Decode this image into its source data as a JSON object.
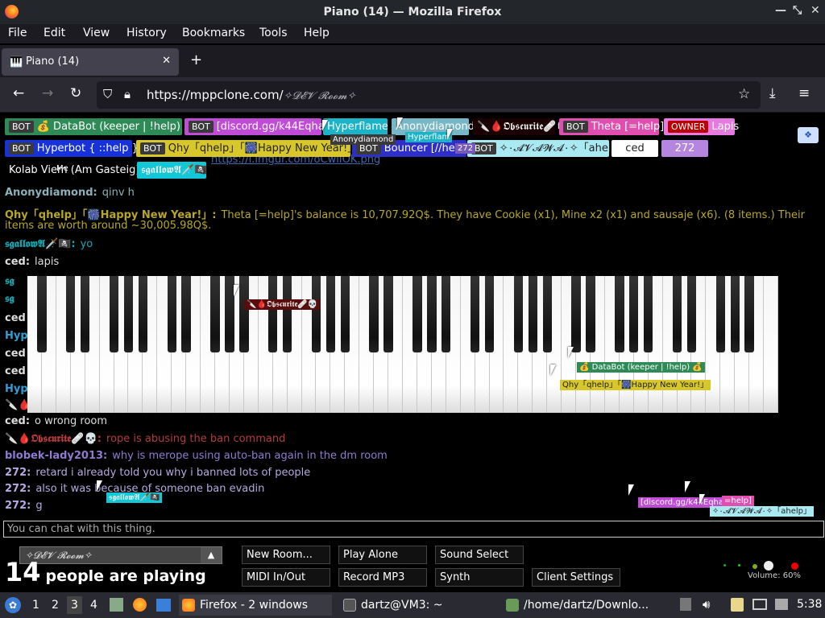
{
  "window": {
    "title": "Piano (14) — Mozilla Firefox"
  },
  "menu": {
    "file": "File",
    "edit": "Edit",
    "view": "View",
    "history": "History",
    "bookmarks": "Bookmarks",
    "tools": "Tools",
    "help": "Help"
  },
  "tab": {
    "label": "Piano (14)",
    "close": "✕",
    "new": "+"
  },
  "nav": {
    "url_host": "https://mppclone.com/",
    "url_path": "✧𝓓𝓔𝓥 𝓡𝓸𝓸𝓶✧"
  },
  "colors": {
    "accent": "#e66bdd",
    "page_bg": "#000000"
  },
  "users_row1": [
    {
      "tag": "BOT",
      "name": "💰 DataBot (keeper | !help) 💰",
      "color": "#2e8b57"
    },
    {
      "tag": "BOT",
      "name": "[discord.gg/k44Eqha]",
      "color": "#c04bd6"
    },
    {
      "tag": "",
      "name": "Hyperflame",
      "color": "#1bb3c7"
    },
    {
      "tag": "",
      "name": "Anonydiamond",
      "color": "#77b7c6"
    },
    {
      "tag": "",
      "name": "🔪🩸𝕺𝖇𝖘𝖈𝖚𝖗𝖎𝖙𝖊🩹💀",
      "color": "#1a0000"
    },
    {
      "tag": "BOT",
      "name": "Theta [=help]",
      "color": "#e04fb0"
    },
    {
      "tag": "OWNER",
      "name": "Lapis",
      "color": "#e77ae0"
    }
  ],
  "users_row2": [
    {
      "tag": "BOT",
      "name": "Hyperbot { ::help }",
      "color": "#1632d8"
    },
    {
      "tag": "BOT",
      "name": "Qhy「qhelp」「🎆Happy New Year!」",
      "color": "#d8c72b"
    },
    {
      "tag": "BOT",
      "name": "Bouncer [//help]",
      "color": "#2e2ec8"
    },
    {
      "tag": "BOT",
      "name": "✧۰𝓐𝓥𝓐𝓦𝓐۰✧「ahelp」",
      "color": "#a9e9f2"
    },
    {
      "tag": "",
      "name": "ced",
      "color": "#ffffff"
    },
    {
      "tag": "",
      "name": "272",
      "color": "#b585e0"
    }
  ],
  "users_row3": [
    {
      "name": "Kolab Viem (Am Gasteig)",
      "color": "#000000"
    },
    {
      "name": "𝖘𝖌𝖆𝖑𝖑𝖔𝖜𝕬🗡️🏴‍☠️",
      "color": "#13c7d6"
    }
  ],
  "me_label": "Me",
  "chat_partial": "https://i.imgur.com/oCwlIOK.png",
  "chat": [
    {
      "name": "Anonydiamond:",
      "text": "qinv h",
      "color": "#8ab0b9"
    },
    {
      "name": "Qhy「qhelp」「🎆Happy New Year!」:",
      "text": "Theta [=help]'s balance is 10,707.92Q$. They have Cookie (x1), Mine x2 (x1) and sausaje (x6). (8 items.) Their",
      "color": "#b8a725"
    },
    {
      "name": "",
      "text": "items are worth around ~30,005.98Q$.",
      "color": "#b8a725"
    },
    {
      "name": "𝖘𝖌𝖆𝖑𝖑𝖔𝖜𝕬🗡️🏴‍☠️:",
      "text": "yo",
      "color": "#13a6b3"
    },
    {
      "name": "ced:",
      "text": "lapis",
      "color": "#dddddd"
    }
  ],
  "chat_side": [
    {
      "name": "𝖘𝖌",
      "color": "#13a6b3"
    },
    {
      "name": "𝖘𝖌",
      "color": "#13a6b3"
    },
    {
      "name": "ced",
      "color": "#dddddd"
    },
    {
      "name": "Hyp",
      "color": "#2e9fd8"
    },
    {
      "name": "ced",
      "color": "#dddddd"
    },
    {
      "name": "ced",
      "color": "#dddddd"
    },
    {
      "name": "Hyp",
      "color": "#2e9fd8"
    },
    {
      "name": "🔪🩸",
      "color": "#cc3333"
    }
  ],
  "chat2": [
    {
      "name": "ced:",
      "text": "o wrong room",
      "color": "#dddddd"
    },
    {
      "name": "🔪🩸𝕺𝖇𝖘𝖈𝖚𝖗𝖎𝖙𝖊🩹💀:",
      "text": "rope is abusing the ban command",
      "color": "#b33b3b"
    },
    {
      "name": "blobek-lady2013:",
      "text": "why is merope using auto-ban again in the dm room",
      "color": "#8f7bd0"
    },
    {
      "name": "272:",
      "text": "retard i already told you why i banned lots of people",
      "color": "#b5a9e0"
    },
    {
      "name": "272:",
      "text": "also it was because of someone ban evadin",
      "color": "#b5a9e0"
    },
    {
      "name": "272:",
      "text": "g",
      "color": "#b5a9e0"
    }
  ],
  "cursors": {
    "obscurite": "🔪🩸𝕺𝖇𝖘𝖈𝖚𝖗𝖎𝖙𝖊🩹💀",
    "databot": "💰 DataBot (keeper | !help) 💰",
    "qhy": "Qhy「qhelp」「🎆Happy New Year!」",
    "anony": "Anonydiamond",
    "hyper": "Hyperflam",
    "c272": "272",
    "sgallow": "𝖘𝖌𝖆𝖑𝖑𝖔𝖜𝕬🗡️🏴‍☠️",
    "discord": "[discord.gg/k44Eqha]",
    "theta": "=help]",
    "avawa": "✧۰𝓐𝓥𝓐𝓦𝓐۰✧「ahelp」"
  },
  "chat_input_placeholder": "You can chat with this thing.",
  "room": {
    "name": "✧𝓓𝓔𝓥 𝓡𝓸𝓸𝓶✧",
    "arrow": "▲"
  },
  "people": {
    "count": "14",
    "text": "people are playing"
  },
  "buttons": {
    "new_room": "New Room...",
    "play_alone": "Play Alone",
    "sound_select": "Sound Select",
    "midi": "MIDI In/Out",
    "record": "Record MP3",
    "synth": "Synth",
    "client_settings": "Client Settings"
  },
  "volume": "Volume: 60%",
  "taskbar": {
    "ws": [
      "1",
      "2",
      "3",
      "4"
    ],
    "tasks": [
      "Firefox - 2 windows",
      "dartz@VM3: ~",
      "/home/dartz/Downlo..."
    ],
    "clock": "5:38"
  }
}
